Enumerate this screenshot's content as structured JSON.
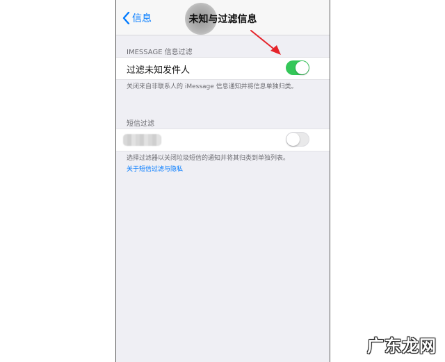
{
  "navbar": {
    "back_label": "信息",
    "title": "未知与过滤信息"
  },
  "imessage_section": {
    "header": "IMESSAGE 信息过滤",
    "filter_cell": {
      "label": "过滤未知发件人",
      "toggle_on": true
    },
    "footer": "关闭来自非联系人的 iMessage 信息通知并将信息单独归类。"
  },
  "sms_section": {
    "header": "短信过滤",
    "filter_cell": {
      "toggle_on": false
    },
    "footer": "选择过滤器以关闭垃圾短信的通知并将其归类到单独列表。",
    "link": "关于短信过滤与隐私"
  },
  "colors": {
    "accent": "#007aff",
    "toggle_on": "#34c759",
    "arrow": "#e5232a"
  },
  "watermark": "广东龙网"
}
